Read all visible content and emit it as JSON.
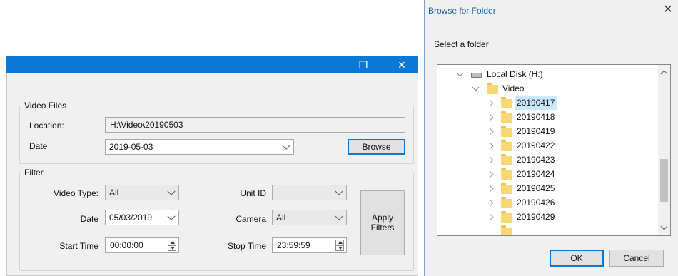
{
  "main_window": {
    "controls": {
      "minimize": "—",
      "restore": "❐",
      "close": "✕"
    },
    "video_files": {
      "group_label": "Video Files",
      "location_label": "Location:",
      "location_value": "H:\\Video\\20190503",
      "date_label": "Date",
      "date_value": "2019-05-03",
      "browse_label": "Browse"
    },
    "filter": {
      "group_label": "Filter",
      "video_type_label": "Video Type:",
      "video_type_value": "All",
      "unit_id_label": "Unit ID",
      "unit_id_value": "",
      "date_label": "Date",
      "date_value": "05/03/2019",
      "camera_label": "Camera",
      "camera_value": "All",
      "start_time_label": "Start Time",
      "start_time_value": "00:00:00",
      "stop_time_label": "Stop Time",
      "stop_time_value": "23:59:59",
      "apply_label_line1": "Apply",
      "apply_label_line2": "Filters"
    }
  },
  "browse_dialog": {
    "title": "Browse for Folder",
    "close": "✕",
    "instruction": "Select a folder",
    "tree": {
      "drive": "Local Disk (H:)",
      "root_folder": "Video",
      "selected": "20190417",
      "folders": [
        "20190417",
        "20190418",
        "20190419",
        "20190422",
        "20190423",
        "20190424",
        "20190425",
        "20190426",
        "20190429"
      ]
    },
    "ok_label": "OK",
    "cancel_label": "Cancel"
  },
  "colors": {
    "titlebar": "#0a78d4",
    "selection": "#cce8ff",
    "dialog_title_text": "#1c5fa8"
  },
  "icons": [
    "minimize-icon",
    "restore-icon",
    "close-icon",
    "drive-icon",
    "folder-icon",
    "chevron-down-icon",
    "chevron-right-icon",
    "spin-up-icon",
    "spin-down-icon"
  ]
}
